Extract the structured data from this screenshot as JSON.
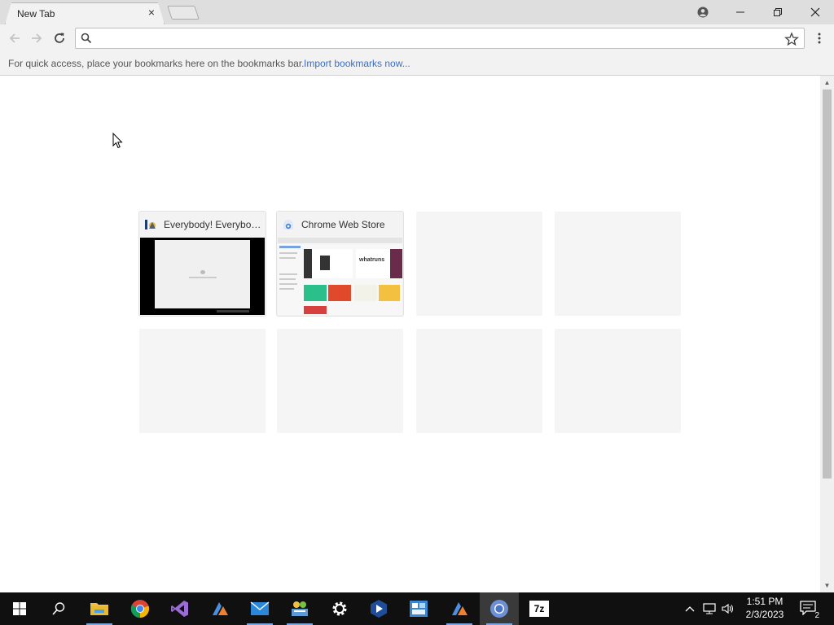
{
  "browser": {
    "tab": {
      "title": "New Tab",
      "close_label": "×"
    },
    "omnibox": {
      "value": "",
      "placeholder": ""
    },
    "bookmarks_bar": {
      "message": "For quick access, place your bookmarks here on the bookmarks bar.",
      "import_link": "Import bookmarks now..."
    }
  },
  "most_visited": [
    {
      "title": "Everybody! Everybody!",
      "icon": "site-favicon",
      "thumb": "black-screen-dialog"
    },
    {
      "title": "Chrome Web Store",
      "icon": "chrome-web-store-icon",
      "thumb": "web-store-page",
      "thumb_text": "whatruns"
    },
    {
      "title": "",
      "empty": true
    },
    {
      "title": "",
      "empty": true
    },
    {
      "title": "",
      "empty": true
    },
    {
      "title": "",
      "empty": true
    },
    {
      "title": "",
      "empty": true
    },
    {
      "title": "",
      "empty": true
    }
  ],
  "taskbar": {
    "apps": [
      "windows-start-icon",
      "search-icon",
      "file-explorer-icon",
      "chrome-icon",
      "visual-studio-icon",
      "app-icon",
      "mail-icon",
      "network-app-icon",
      "settings-gear-icon",
      "video-app-icon",
      "dashboard-app-icon",
      "app-icon-2",
      "chromium-icon",
      "7zip-icon"
    ],
    "sevenzip_label": "7z",
    "clock": {
      "time": "1:51 PM",
      "date": "2/3/2023"
    },
    "notification_count": "2"
  },
  "colors": {
    "tabstrip": "#dedede",
    "toolbar": "#f2f2f2",
    "link": "#3a6fc4",
    "taskbar": "#101010"
  }
}
